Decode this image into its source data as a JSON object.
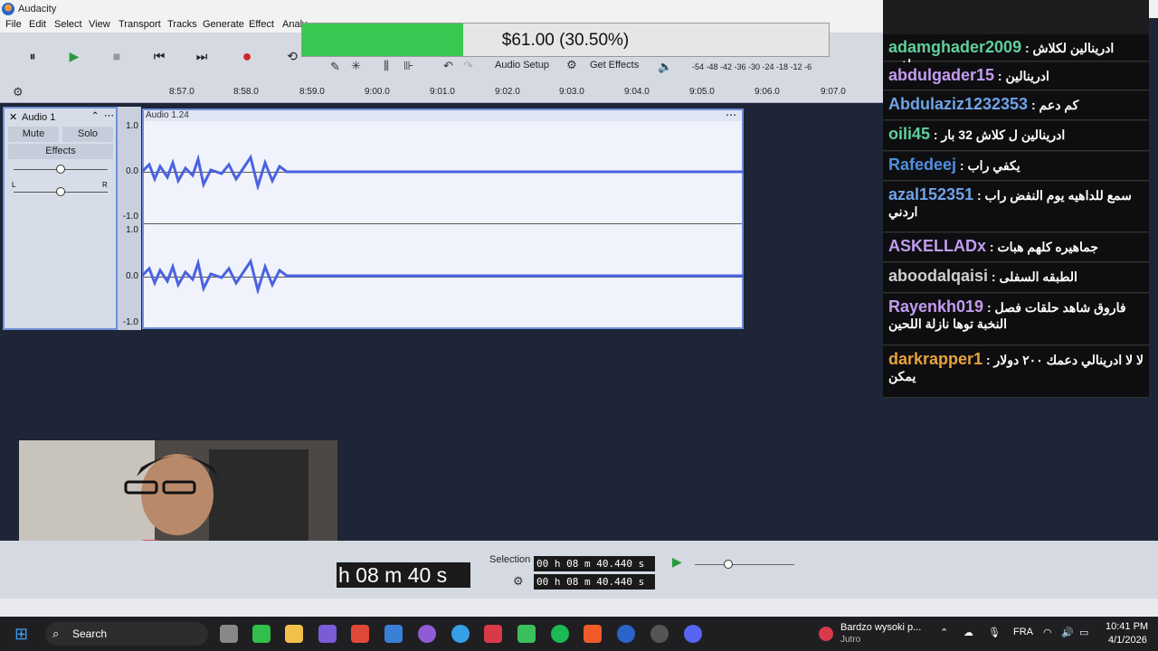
{
  "window": {
    "title": "Audacity",
    "btn_min": "─",
    "btn_max": "▢",
    "btn_close": "✕"
  },
  "menu": [
    "File",
    "Edit",
    "Select",
    "View",
    "Transport",
    "Tracks",
    "Generate",
    "Effect",
    "Analy"
  ],
  "toolbar": {
    "pause": "⏸",
    "play": "▶",
    "stop": "■",
    "skip_start": "⏮",
    "skip_end": "⏭",
    "record": "●",
    "loop": "⟲",
    "audio_setup": "Audio Setup",
    "get_effects": "Get Effects",
    "meter_label": "-54  -48  -42  -36  -30  -24  -18  -12  -6"
  },
  "timeline": {
    "ticks": [
      "8:57.0",
      "8:58.0",
      "8:59.0",
      "9:00.0",
      "9:01.0",
      "9:02.0",
      "9:03.0",
      "9:04.0",
      "9:05.0",
      "9:06.0",
      "9:07.0"
    ]
  },
  "track": {
    "name": "Audio 1",
    "mute": "Mute",
    "solo": "Solo",
    "effects": "Effects",
    "clip_name": "Audio 1.24",
    "pan_l": "L",
    "pan_r": "R",
    "scale_top": [
      "1.0",
      "0.0",
      "-1.0"
    ],
    "scale_bottom": [
      "1.0",
      "0.0",
      "-1.0"
    ]
  },
  "donation": {
    "label": "$61.00 (30.50%)",
    "progress": 0.305
  },
  "chat": [
    {
      "user": "adamghader2009",
      "msg": "ادرينالين لكلاش حلفت",
      "color": "#5fcf9d"
    },
    {
      "user": "abdulgader15",
      "msg": "ادرينالين",
      "color": "#c39bf0"
    },
    {
      "user": "Abdulaziz1232353",
      "msg": "كم دعم",
      "color": "#6fa3e8"
    },
    {
      "user": "oili45",
      "msg": "ادرينالين ل كلاش 32 بار",
      "color": "#5fcf9d"
    },
    {
      "user": "Rafedeej",
      "msg": "يكفي راب",
      "color": "#4e8fe0"
    },
    {
      "user": "azal152351",
      "msg": "سمع للداهيه يوم النفض راب اردني",
      "color": "#6fa3e8"
    },
    {
      "user": "ASKELLADx",
      "msg": "جماهيره كلهم هبات",
      "color": "#c39bf0"
    },
    {
      "user": "aboodalqaisi",
      "msg": "الطبقه السفلى",
      "color": "#cfcfcf"
    },
    {
      "user": "Rayenkh019",
      "msg": "فاروق شاهد حلقات فصل النخبة توها نازلة اللحين",
      "color": "#c39bf0"
    },
    {
      "user": "darkrapper1",
      "msg": "لا لا ادرينالي دعمك ٢٠٠ دولار يمكن",
      "color": "#e8a33a"
    }
  ],
  "bottom": {
    "big_time": "h 08 m 40 s",
    "selection_label": "Selection",
    "sel_start": "00 h 08 m 40.440 s",
    "sel_end": "00 h 08 m 40.440 s"
  },
  "taskbar": {
    "search": "Search",
    "media_title": "Bardzo wysoki p...",
    "media_sub": "Jutro",
    "lang": "FRA",
    "time": "10:41 PM",
    "date": "4/1/2026"
  }
}
